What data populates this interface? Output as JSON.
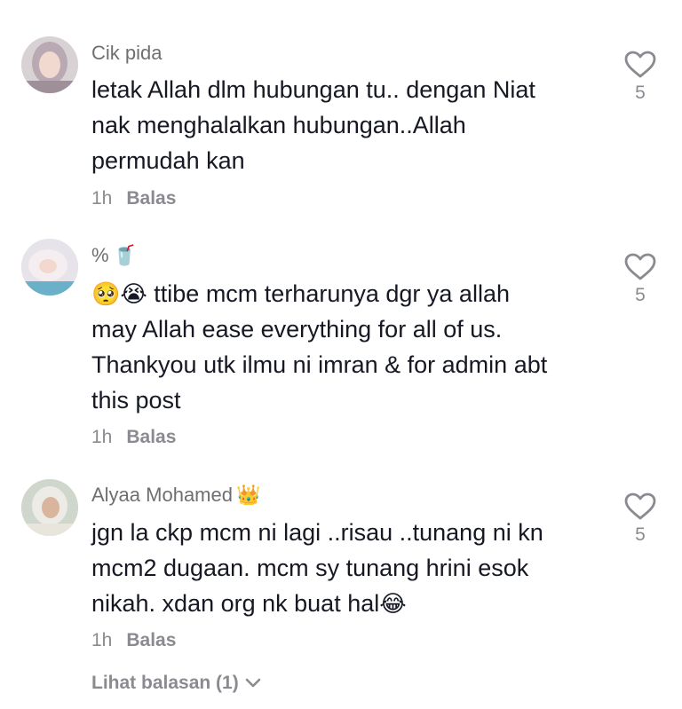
{
  "comments": [
    {
      "username": "Cik pida",
      "username_emoji": "",
      "text_lines": [
        "letak Allah dlm hubungan tu.. dengan Niat",
        "nak menghalalkan hubungan..Allah",
        "permudah kan"
      ],
      "time": "1h",
      "reply_label": "Balas",
      "likes": "5"
    },
    {
      "username": "%",
      "username_emoji": "🥤",
      "lead_emoji": "🥺😭",
      "text_lines": [
        "ttibe mcm terharunya dgr ya allah",
        "may Allah ease everything for all of us.",
        "Thankyou utk ilmu ni imran & for admin abt",
        "this post"
      ],
      "time": "1h",
      "reply_label": "Balas",
      "likes": "5"
    },
    {
      "username": "Alyaa Mohamed",
      "username_emoji": "👑",
      "text_lines": [
        "jgn la ckp mcm ni lagi ..risau ..tunang ni kn",
        "mcm2 dugaan. mcm sy tunang hrini esok",
        "nikah. xdan org nk buat hal"
      ],
      "trail_emoji": "😂",
      "time": "1h",
      "reply_label": "Balas",
      "likes": "5",
      "view_replies": "Lihat balasan (1)"
    }
  ],
  "colors": {
    "text": "#161823",
    "muted": "#8a8b91",
    "username": "#6f6f73"
  },
  "icons": {
    "like": "heart-outline-icon",
    "expand": "chevron-down-icon"
  }
}
